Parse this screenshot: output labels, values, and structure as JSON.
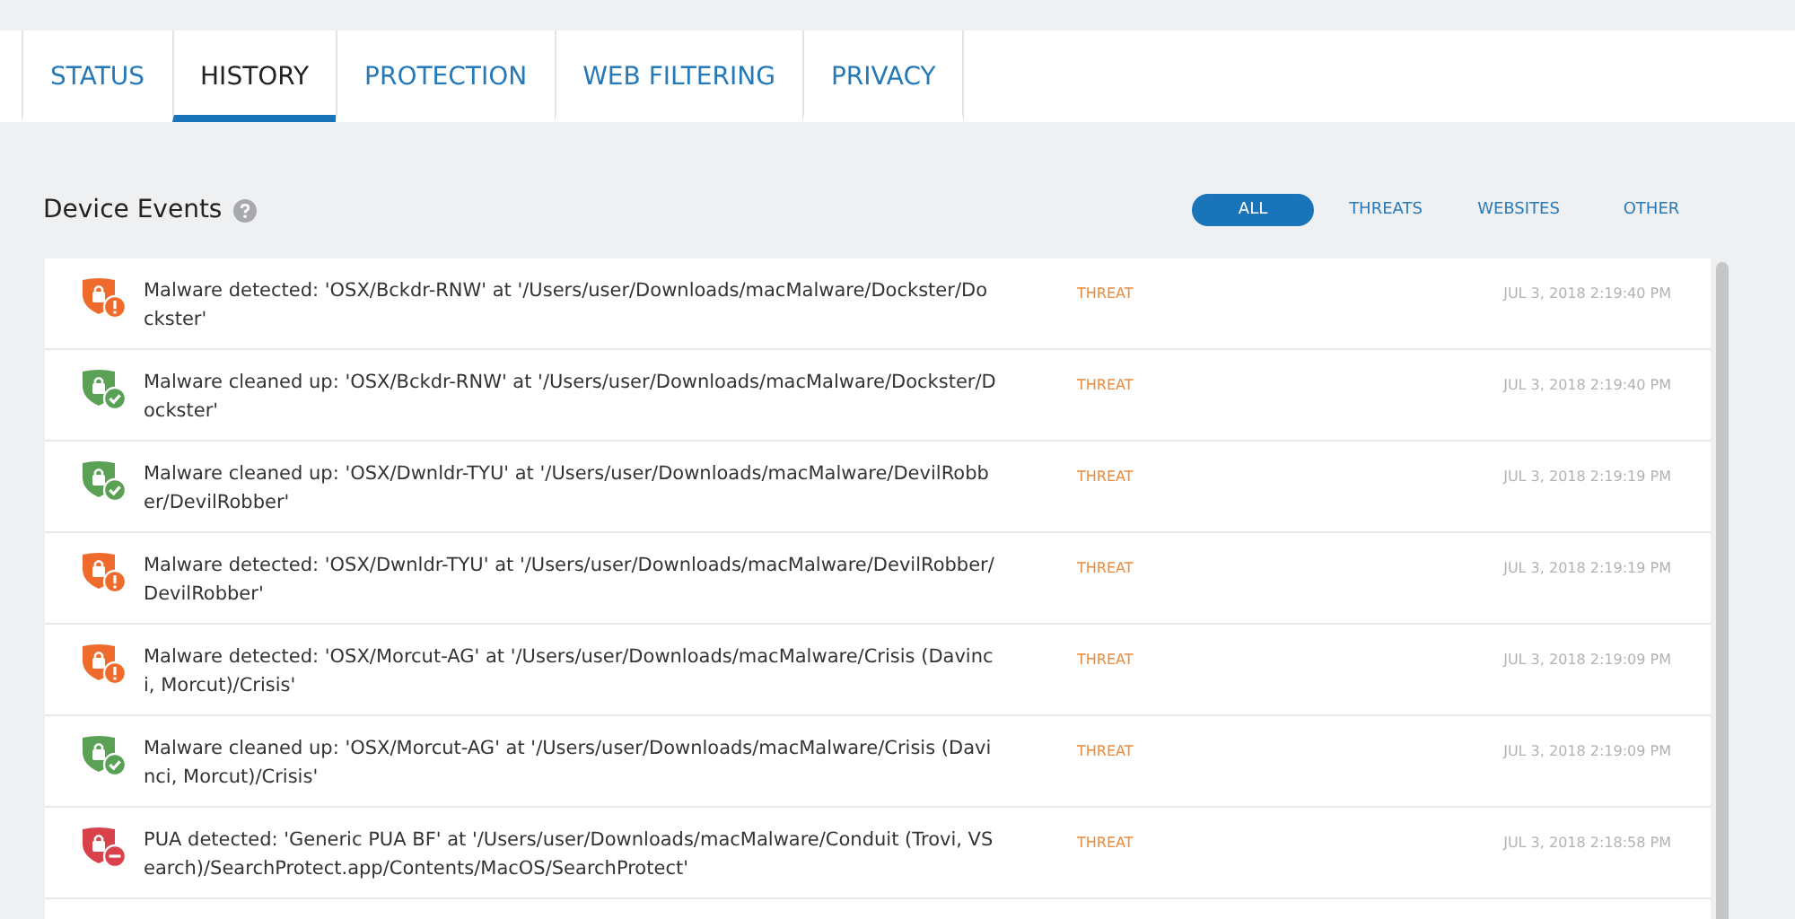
{
  "tabs": [
    {
      "label": "STATUS",
      "selected": false
    },
    {
      "label": "HISTORY",
      "selected": true
    },
    {
      "label": "PROTECTION",
      "selected": false
    },
    {
      "label": "WEB FILTERING",
      "selected": false
    },
    {
      "label": "PRIVACY",
      "selected": false
    }
  ],
  "section": {
    "title": "Device Events"
  },
  "filters": [
    {
      "label": "ALL",
      "selected": true
    },
    {
      "label": "THREATS",
      "selected": false
    },
    {
      "label": "WEBSITES",
      "selected": false
    },
    {
      "label": "OTHER",
      "selected": false
    }
  ],
  "events": [
    {
      "kind": "detected",
      "message": "Malware detected: 'OSX/Bckdr-RNW' at '/Users/user/Downloads/macMalware/Dockster/Dockster'",
      "category": "THREAT",
      "time": "JUL 3, 2018 2:19:40 PM"
    },
    {
      "kind": "cleaned",
      "message": "Malware cleaned up: 'OSX/Bckdr-RNW' at '/Users/user/Downloads/macMalware/Dockster/Dockster'",
      "category": "THREAT",
      "time": "JUL 3, 2018 2:19:40 PM"
    },
    {
      "kind": "cleaned",
      "message": "Malware cleaned up: 'OSX/Dwnldr-TYU' at '/Users/user/Downloads/macMalware/DevilRobber/DevilRobber'",
      "category": "THREAT",
      "time": "JUL 3, 2018 2:19:19 PM"
    },
    {
      "kind": "detected",
      "message": "Malware detected: 'OSX/Dwnldr-TYU' at '/Users/user/Downloads/macMalware/DevilRobber/DevilRobber'",
      "category": "THREAT",
      "time": "JUL 3, 2018 2:19:19 PM"
    },
    {
      "kind": "detected",
      "message": "Malware detected: 'OSX/Morcut-AG' at '/Users/user/Downloads/macMalware/Crisis (Davinci, Morcut)/Crisis'",
      "category": "THREAT",
      "time": "JUL 3, 2018 2:19:09 PM"
    },
    {
      "kind": "cleaned",
      "message": "Malware cleaned up: 'OSX/Morcut-AG' at '/Users/user/Downloads/macMalware/Crisis (Davinci, Morcut)/Crisis'",
      "category": "THREAT",
      "time": "JUL 3, 2018 2:19:09 PM"
    },
    {
      "kind": "pua",
      "message": "PUA detected: 'Generic PUA BF' at '/Users/user/Downloads/macMalware/Conduit (Trovi, VSearch)/SearchProtect.app/Contents/MacOS/SearchProtect'",
      "category": "THREAT",
      "time": "JUL 3, 2018 2:18:58 PM"
    }
  ]
}
